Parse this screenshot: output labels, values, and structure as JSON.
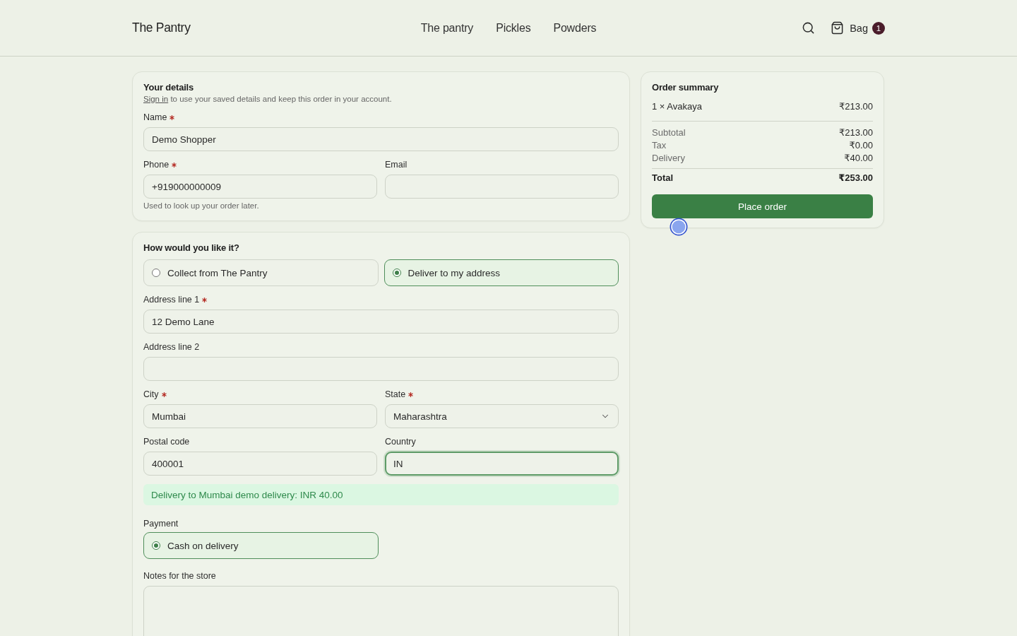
{
  "header": {
    "logo": "The Pantry",
    "nav": [
      {
        "label": "The pantry"
      },
      {
        "label": "Pickles"
      },
      {
        "label": "Powders"
      }
    ],
    "bag_label": "Bag",
    "bag_count": "1"
  },
  "details": {
    "title": "Your details",
    "sign_in": {
      "link": "Sign in",
      "text": "to use your saved details and keep this order in your account."
    },
    "rows": [
      {
        "fields": [
          {
            "kind": "text",
            "label": "Name",
            "required": true,
            "value": "Demo Shopper",
            "focused": false
          }
        ]
      },
      {
        "fields": [
          {
            "kind": "text",
            "label": "Phone",
            "required": true,
            "value": "+919000000009",
            "focused": false
          },
          {
            "kind": "text",
            "label": "Email",
            "required": false,
            "focused": false
          }
        ]
      }
    ],
    "hint": "Used to look up your order later."
  },
  "fulfillment": {
    "title": "How would you like it?",
    "options": [
      {
        "label": "Collect from The Pantry",
        "selected": false
      },
      {
        "label": "Deliver to my address",
        "selected": true
      }
    ],
    "rows": [
      {
        "fields": [
          {
            "kind": "text",
            "label": "Address line 1",
            "required": true,
            "value": "12 Demo Lane",
            "focused": false
          }
        ]
      },
      {
        "fields": [
          {
            "kind": "text",
            "label": "Address line 2",
            "required": false,
            "focused": false
          }
        ]
      },
      {
        "fields": [
          {
            "kind": "text",
            "label": "City",
            "required": true,
            "value": "Mumbai",
            "focused": false
          },
          {
            "kind": "select",
            "label": "State",
            "required": true,
            "value": "Maharashtra",
            "focused": false
          }
        ]
      },
      {
        "fields": [
          {
            "kind": "text",
            "label": "Postal code",
            "required": false,
            "value": "400001",
            "focused": false
          },
          {
            "kind": "text",
            "label": "Country",
            "required": false,
            "value": "IN",
            "focused": true
          }
        ]
      }
    ],
    "notice": "Delivery to Mumbai demo delivery: INR 40.00",
    "payment": {
      "label": "Payment",
      "options": [
        {
          "label": "Cash on delivery",
          "selected": true
        }
      ]
    },
    "notes": {
      "kind": "textarea",
      "label": "Notes for the store",
      "required": false,
      "focused": false
    }
  },
  "summary": {
    "title": "Order summary",
    "items": [
      {
        "label": "1 × Avakaya",
        "price": "₹213.00"
      }
    ],
    "lines": [
      {
        "label": "Subtotal",
        "amount": "₹213.00"
      },
      {
        "label": "Tax",
        "amount": "₹0.00"
      },
      {
        "label": "Delivery",
        "amount": "₹40.00"
      }
    ],
    "total": {
      "label": "Total",
      "amount": "₹253.00"
    },
    "button": "Place order"
  }
}
